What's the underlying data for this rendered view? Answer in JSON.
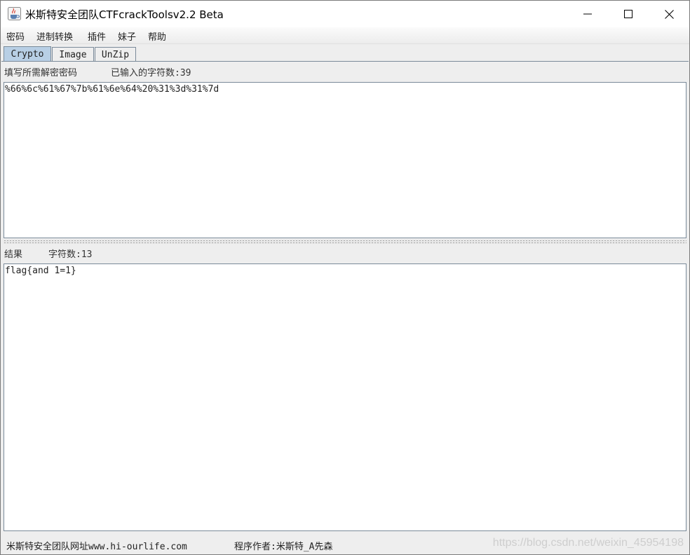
{
  "window": {
    "title": "米斯特安全团队CTFcrackToolsv2.2 Beta"
  },
  "menu": {
    "items": [
      "密码",
      "进制转换",
      "插件",
      "妹子",
      "帮助"
    ]
  },
  "tabs": {
    "items": [
      {
        "label": "Crypto",
        "active": true
      },
      {
        "label": "Image",
        "active": false
      },
      {
        "label": "UnZip",
        "active": false
      }
    ]
  },
  "input_section": {
    "label": "填写所需解密密码",
    "count_label": "已输入的字符数:39",
    "value": "%66%6c%61%67%7b%61%6e%64%20%31%3d%31%7d"
  },
  "result_section": {
    "label": "结果",
    "count_label": "字符数:13",
    "value": "flag{and 1=1}"
  },
  "footer": {
    "website": "米斯特安全团队网址www.hi-ourlife.com",
    "author": "程序作者:米斯特_A先森",
    "watermark": "https://blog.csdn.net/weixin_45954198"
  },
  "colors": {
    "active_tab": "#b8cfe5",
    "border": "#7a8a99"
  }
}
